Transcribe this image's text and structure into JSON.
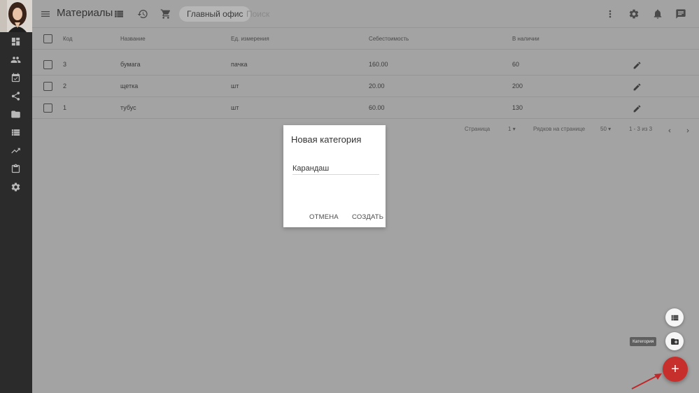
{
  "app": {
    "title": "Материалы"
  },
  "toolbar": {
    "office_chip": "Главный офис",
    "search_placeholder": "Поиск"
  },
  "table": {
    "columns": [
      "Код",
      "Название",
      "Ед. измерения",
      "Себестоимость",
      "В наличии"
    ],
    "rows": [
      {
        "code": "3",
        "name": "бумага",
        "unit": "пачка",
        "cost": "160.00",
        "stock": "60"
      },
      {
        "code": "2",
        "name": "щетка",
        "unit": "шт",
        "cost": "20.00",
        "stock": "200"
      },
      {
        "code": "1",
        "name": "тубус",
        "unit": "шт",
        "cost": "60.00",
        "stock": "130"
      }
    ]
  },
  "pagination": {
    "page_label": "Страница",
    "page_value": "1",
    "rows_label": "Рядков на странице",
    "rows_value": "50",
    "range": "1 - 3 из 3"
  },
  "dialog": {
    "title": "Новая категория",
    "input_value": "Карандаш",
    "cancel_label": "ОТМЕНА",
    "create_label": "СОЗДАТЬ"
  },
  "fab": {
    "tooltip": "Категория",
    "main_label": "+"
  },
  "colors": {
    "fab_red": "#c62f2c",
    "sidebar_bg": "#2b2b2b",
    "overlay_bg": "#a3a3a3"
  }
}
